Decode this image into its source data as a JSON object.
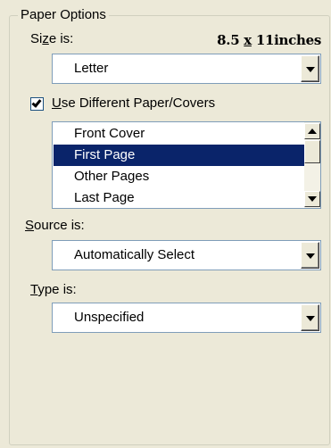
{
  "group": {
    "title": "Paper Options"
  },
  "size": {
    "label_prefix": "Si",
    "label_accel": "z",
    "label_suffix": "e is:",
    "dims_left": "8.5",
    "dims_x": "x",
    "dims_right": "11",
    "dims_unit": "inches",
    "selected": "Letter"
  },
  "use_different": {
    "label_accel": "U",
    "label_rest": "se Different Paper/Covers",
    "checked": true
  },
  "pages_list": {
    "items": [
      {
        "label": "Front Cover",
        "selected": false
      },
      {
        "label": "First Page",
        "selected": true
      },
      {
        "label": "Other Pages",
        "selected": false
      },
      {
        "label": "Last Page",
        "selected": false
      }
    ]
  },
  "source": {
    "label_accel": "S",
    "label_rest": "ource is:",
    "selected": "Automatically Select"
  },
  "type": {
    "label_accel": "T",
    "label_rest": "ype is:",
    "selected": "Unspecified"
  },
  "icons": {
    "dropdown": "chevron-down-icon",
    "check": "check-icon",
    "scroll_up": "arrow-up-icon",
    "scroll_down": "arrow-down-icon"
  },
  "colors": {
    "background": "#ece9d8",
    "selection": "#0a246a",
    "field_border": "#7f9db9"
  }
}
